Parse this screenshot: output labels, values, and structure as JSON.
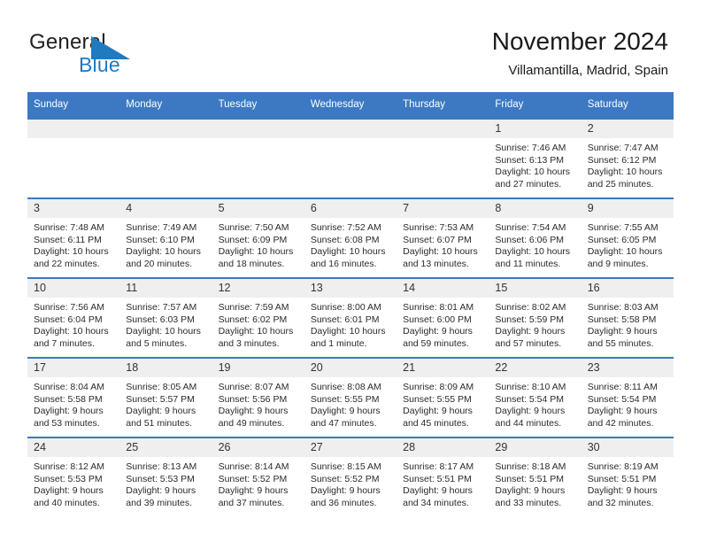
{
  "brand": {
    "name_part1": "General",
    "name_part2": "Blue",
    "logo_icon": "blue-triangle-icon",
    "accent_color": "#1f7ac0"
  },
  "header": {
    "title": "November 2024",
    "location": "Villamantilla, Madrid, Spain"
  },
  "theme": {
    "header_blue": "#3c79c2",
    "daynum_band": "#efefef",
    "text": "#1a1a1a"
  },
  "weekdays": [
    "Sunday",
    "Monday",
    "Tuesday",
    "Wednesday",
    "Thursday",
    "Friday",
    "Saturday"
  ],
  "labels": {
    "sunrise": "Sunrise:",
    "sunset": "Sunset:",
    "daylight": "Daylight:"
  },
  "weeks": [
    [
      {
        "day": "",
        "blank": true
      },
      {
        "day": "",
        "blank": true
      },
      {
        "day": "",
        "blank": true
      },
      {
        "day": "",
        "blank": true
      },
      {
        "day": "",
        "blank": true
      },
      {
        "day": "1",
        "sunrise": "Sunrise: 7:46 AM",
        "sunset": "Sunset: 6:13 PM",
        "daylight1": "Daylight: 10 hours",
        "daylight2": "and 27 minutes."
      },
      {
        "day": "2",
        "sunrise": "Sunrise: 7:47 AM",
        "sunset": "Sunset: 6:12 PM",
        "daylight1": "Daylight: 10 hours",
        "daylight2": "and 25 minutes."
      }
    ],
    [
      {
        "day": "3",
        "sunrise": "Sunrise: 7:48 AM",
        "sunset": "Sunset: 6:11 PM",
        "daylight1": "Daylight: 10 hours",
        "daylight2": "and 22 minutes."
      },
      {
        "day": "4",
        "sunrise": "Sunrise: 7:49 AM",
        "sunset": "Sunset: 6:10 PM",
        "daylight1": "Daylight: 10 hours",
        "daylight2": "and 20 minutes."
      },
      {
        "day": "5",
        "sunrise": "Sunrise: 7:50 AM",
        "sunset": "Sunset: 6:09 PM",
        "daylight1": "Daylight: 10 hours",
        "daylight2": "and 18 minutes."
      },
      {
        "day": "6",
        "sunrise": "Sunrise: 7:52 AM",
        "sunset": "Sunset: 6:08 PM",
        "daylight1": "Daylight: 10 hours",
        "daylight2": "and 16 minutes."
      },
      {
        "day": "7",
        "sunrise": "Sunrise: 7:53 AM",
        "sunset": "Sunset: 6:07 PM",
        "daylight1": "Daylight: 10 hours",
        "daylight2": "and 13 minutes."
      },
      {
        "day": "8",
        "sunrise": "Sunrise: 7:54 AM",
        "sunset": "Sunset: 6:06 PM",
        "daylight1": "Daylight: 10 hours",
        "daylight2": "and 11 minutes."
      },
      {
        "day": "9",
        "sunrise": "Sunrise: 7:55 AM",
        "sunset": "Sunset: 6:05 PM",
        "daylight1": "Daylight: 10 hours",
        "daylight2": "and 9 minutes."
      }
    ],
    [
      {
        "day": "10",
        "sunrise": "Sunrise: 7:56 AM",
        "sunset": "Sunset: 6:04 PM",
        "daylight1": "Daylight: 10 hours",
        "daylight2": "and 7 minutes."
      },
      {
        "day": "11",
        "sunrise": "Sunrise: 7:57 AM",
        "sunset": "Sunset: 6:03 PM",
        "daylight1": "Daylight: 10 hours",
        "daylight2": "and 5 minutes."
      },
      {
        "day": "12",
        "sunrise": "Sunrise: 7:59 AM",
        "sunset": "Sunset: 6:02 PM",
        "daylight1": "Daylight: 10 hours",
        "daylight2": "and 3 minutes."
      },
      {
        "day": "13",
        "sunrise": "Sunrise: 8:00 AM",
        "sunset": "Sunset: 6:01 PM",
        "daylight1": "Daylight: 10 hours",
        "daylight2": "and 1 minute."
      },
      {
        "day": "14",
        "sunrise": "Sunrise: 8:01 AM",
        "sunset": "Sunset: 6:00 PM",
        "daylight1": "Daylight: 9 hours",
        "daylight2": "and 59 minutes."
      },
      {
        "day": "15",
        "sunrise": "Sunrise: 8:02 AM",
        "sunset": "Sunset: 5:59 PM",
        "daylight1": "Daylight: 9 hours",
        "daylight2": "and 57 minutes."
      },
      {
        "day": "16",
        "sunrise": "Sunrise: 8:03 AM",
        "sunset": "Sunset: 5:58 PM",
        "daylight1": "Daylight: 9 hours",
        "daylight2": "and 55 minutes."
      }
    ],
    [
      {
        "day": "17",
        "sunrise": "Sunrise: 8:04 AM",
        "sunset": "Sunset: 5:58 PM",
        "daylight1": "Daylight: 9 hours",
        "daylight2": "and 53 minutes."
      },
      {
        "day": "18",
        "sunrise": "Sunrise: 8:05 AM",
        "sunset": "Sunset: 5:57 PM",
        "daylight1": "Daylight: 9 hours",
        "daylight2": "and 51 minutes."
      },
      {
        "day": "19",
        "sunrise": "Sunrise: 8:07 AM",
        "sunset": "Sunset: 5:56 PM",
        "daylight1": "Daylight: 9 hours",
        "daylight2": "and 49 minutes."
      },
      {
        "day": "20",
        "sunrise": "Sunrise: 8:08 AM",
        "sunset": "Sunset: 5:55 PM",
        "daylight1": "Daylight: 9 hours",
        "daylight2": "and 47 minutes."
      },
      {
        "day": "21",
        "sunrise": "Sunrise: 8:09 AM",
        "sunset": "Sunset: 5:55 PM",
        "daylight1": "Daylight: 9 hours",
        "daylight2": "and 45 minutes."
      },
      {
        "day": "22",
        "sunrise": "Sunrise: 8:10 AM",
        "sunset": "Sunset: 5:54 PM",
        "daylight1": "Daylight: 9 hours",
        "daylight2": "and 44 minutes."
      },
      {
        "day": "23",
        "sunrise": "Sunrise: 8:11 AM",
        "sunset": "Sunset: 5:54 PM",
        "daylight1": "Daylight: 9 hours",
        "daylight2": "and 42 minutes."
      }
    ],
    [
      {
        "day": "24",
        "sunrise": "Sunrise: 8:12 AM",
        "sunset": "Sunset: 5:53 PM",
        "daylight1": "Daylight: 9 hours",
        "daylight2": "and 40 minutes."
      },
      {
        "day": "25",
        "sunrise": "Sunrise: 8:13 AM",
        "sunset": "Sunset: 5:53 PM",
        "daylight1": "Daylight: 9 hours",
        "daylight2": "and 39 minutes."
      },
      {
        "day": "26",
        "sunrise": "Sunrise: 8:14 AM",
        "sunset": "Sunset: 5:52 PM",
        "daylight1": "Daylight: 9 hours",
        "daylight2": "and 37 minutes."
      },
      {
        "day": "27",
        "sunrise": "Sunrise: 8:15 AM",
        "sunset": "Sunset: 5:52 PM",
        "daylight1": "Daylight: 9 hours",
        "daylight2": "and 36 minutes."
      },
      {
        "day": "28",
        "sunrise": "Sunrise: 8:17 AM",
        "sunset": "Sunset: 5:51 PM",
        "daylight1": "Daylight: 9 hours",
        "daylight2": "and 34 minutes."
      },
      {
        "day": "29",
        "sunrise": "Sunrise: 8:18 AM",
        "sunset": "Sunset: 5:51 PM",
        "daylight1": "Daylight: 9 hours",
        "daylight2": "and 33 minutes."
      },
      {
        "day": "30",
        "sunrise": "Sunrise: 8:19 AM",
        "sunset": "Sunset: 5:51 PM",
        "daylight1": "Daylight: 9 hours",
        "daylight2": "and 32 minutes."
      }
    ]
  ]
}
